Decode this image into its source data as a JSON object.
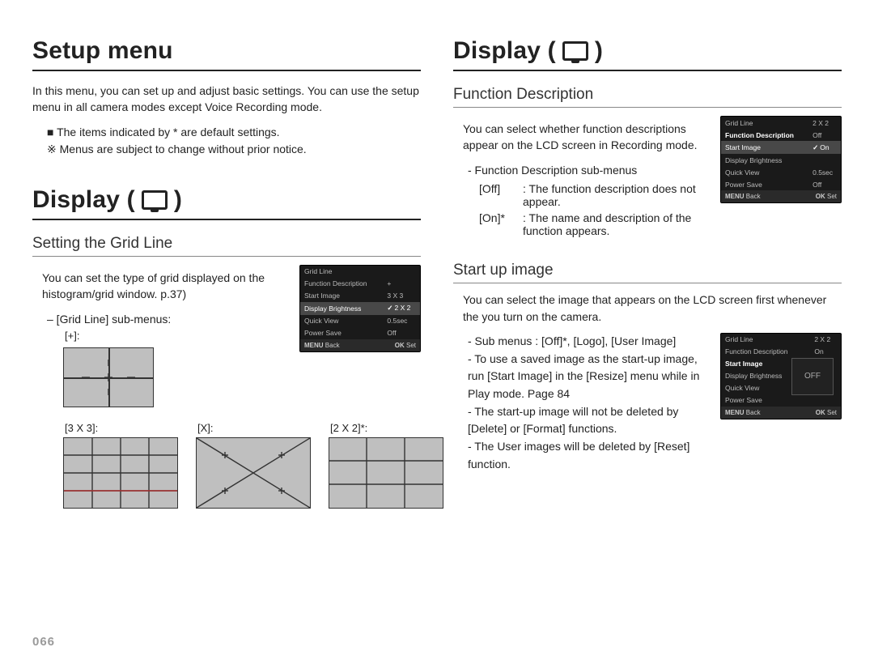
{
  "pageNumber": "066",
  "left": {
    "h1": "Setup menu",
    "intro": "In this menu, you can set up and adjust basic settings. You can use the setup menu in all camera modes except Voice Recording mode.",
    "bullet1_prefix": "■ ",
    "bullet1": "The items indicated by * are default settings.",
    "bullet2_prefix": "※ ",
    "bullet2": "Menus are subject to change without prior notice.",
    "h1b_pre": "Display ( ",
    "h1b_post": " )",
    "sec1_h2": "Setting the Grid Line",
    "sec1_p": "You can set the type of grid displayed on the histogram/grid window. p.37)",
    "sec1_sub": "– [Grid Line] sub-menus:",
    "grid_labels": {
      "plus": "[+]:",
      "threeByThree": "[3 X 3]:",
      "x": "[X]:",
      "twoByTwo": "[2 X 2]*:"
    },
    "camshot_gridline": {
      "rows": [
        {
          "k": "Grid Line",
          "v": ""
        },
        {
          "k": "Function Description",
          "v": "+"
        },
        {
          "k": "Start Image",
          "v": "3 X 3"
        },
        {
          "k": "Display Brightness",
          "v": "X",
          "sel": true,
          "checkv": "2 X 2"
        },
        {
          "k": "Quick View",
          "v": "0.5sec"
        },
        {
          "k": "Power Save",
          "v": "Off"
        }
      ],
      "backLabel": "Back",
      "backKey": "MENU",
      "setLabel": "Set",
      "setKey": "OK"
    }
  },
  "right": {
    "h1_pre": "Display ( ",
    "h1_post": " )",
    "sec1_h2": "Function Description",
    "sec1_p": "You can select whether function descriptions appear on the LCD screen in Recording mode.",
    "sec1_sub": "- Function Description sub-menus",
    "opt_off_k": "[Off]",
    "opt_off_v": ": The function description does not appear.",
    "opt_on_k": "[On]*",
    "opt_on_v": ": The name and description of the function appears.",
    "camshot_fd": {
      "rows": [
        {
          "k": "Grid Line",
          "v": "2 X 2"
        },
        {
          "k": "Function Description",
          "v": "Off",
          "hi": true
        },
        {
          "k": "Start Image",
          "v": "On",
          "sel": true,
          "check": true
        },
        {
          "k": "Display Brightness",
          "v": ""
        },
        {
          "k": "Quick View",
          "v": "0.5sec"
        },
        {
          "k": "Power Save",
          "v": "Off"
        }
      ],
      "backLabel": "Back",
      "backKey": "MENU",
      "setLabel": "Set",
      "setKey": "OK"
    },
    "sec2_h2": "Start up image",
    "sec2_p": "You can select the image that appears on the LCD screen first whenever the you turn on the camera.",
    "sec2_b1": "- Sub menus : [Off]*, [Logo], [User Image]",
    "sec2_b2": "- To use a saved image as the start-up image, run [Start Image] in the [Resize] menu while in Play mode. Page 84",
    "sec2_b3": "- The start-up image will not be deleted by [Delete] or [Format] functions.",
    "sec2_b4": "- The User images will be deleted by [Reset] function.",
    "camshot_si": {
      "rows": [
        {
          "k": "Grid Line",
          "v": "2 X 2"
        },
        {
          "k": "Function Description",
          "v": "On"
        },
        {
          "k": "Start Image",
          "v": "",
          "hi": true
        },
        {
          "k": "Display Brightness",
          "v": ""
        },
        {
          "k": "Quick View",
          "v": ""
        },
        {
          "k": "Power Save",
          "v": ""
        }
      ],
      "thumb": "OFF",
      "backLabel": "Back",
      "backKey": "MENU",
      "setLabel": "Set",
      "setKey": "OK"
    }
  }
}
